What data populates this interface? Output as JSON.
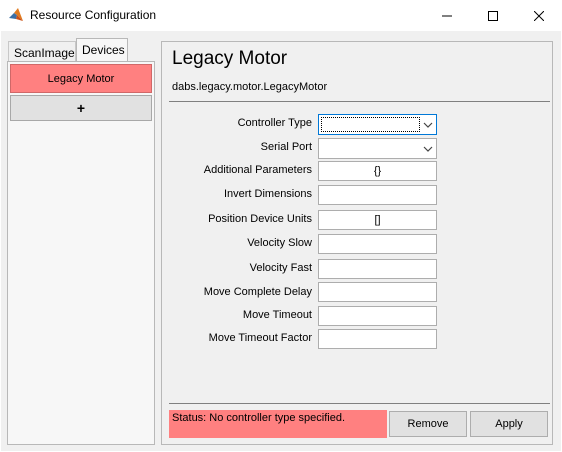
{
  "window": {
    "title": "Resource Configuration",
    "icon": "matlab-logo-icon"
  },
  "tabs": [
    {
      "label": "ScanImage",
      "selected": false
    },
    {
      "label": "Devices",
      "selected": true
    }
  ],
  "devices": {
    "items": [
      {
        "label": "Legacy Motor",
        "selected": true
      }
    ],
    "add_label": "+"
  },
  "device_config": {
    "title": "Legacy Motor",
    "class_name": "dabs.legacy.motor.LegacyMotor",
    "fields": {
      "controller_type": {
        "label": "Controller Type",
        "value": ""
      },
      "serial_port": {
        "label": "Serial Port",
        "value": ""
      },
      "additional_parameters": {
        "label": "Additional Parameters",
        "value": "{}"
      },
      "invert_dimensions": {
        "label": "Invert Dimensions",
        "value": ""
      },
      "position_device_units": {
        "label": "Position Device Units",
        "value": "[]"
      },
      "velocity_slow": {
        "label": "Velocity Slow",
        "value": ""
      },
      "velocity_fast": {
        "label": "Velocity Fast",
        "value": ""
      },
      "move_complete_delay": {
        "label": "Move Complete Delay",
        "value": ""
      },
      "move_timeout": {
        "label": "Move Timeout",
        "value": ""
      },
      "move_timeout_factor": {
        "label": "Move Timeout Factor",
        "value": ""
      }
    }
  },
  "status": {
    "text": "Status: No controller type specified.",
    "color": "#ff8080"
  },
  "buttons": {
    "remove": "Remove",
    "apply": "Apply"
  },
  "colors": {
    "selected_device": "#ff8080",
    "focus_border": "#0078d7"
  }
}
